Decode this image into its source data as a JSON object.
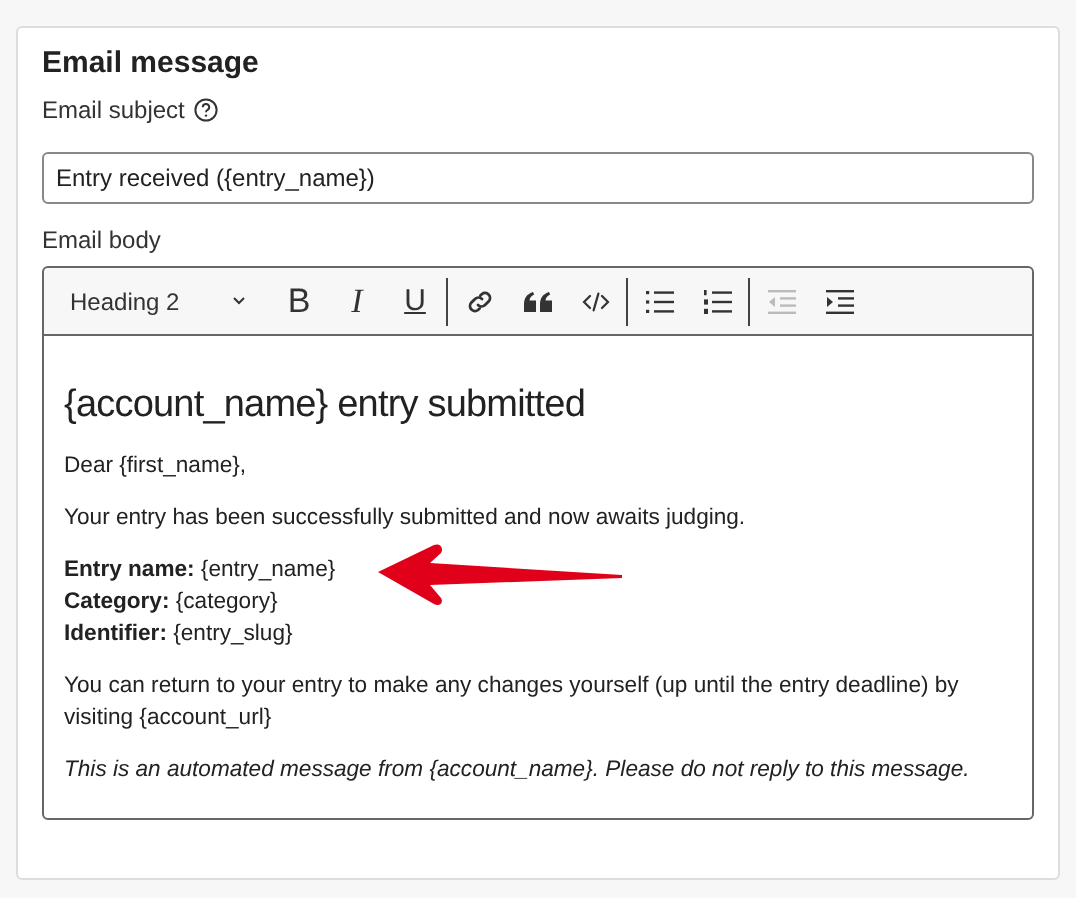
{
  "card": {
    "title": "Email message"
  },
  "subject": {
    "label": "Email subject",
    "value": "Entry received ({entry_name})"
  },
  "body": {
    "label": "Email body",
    "toolbar": {
      "block_style": "Heading 2",
      "groups": [
        [
          {
            "kind": "text",
            "label": "B",
            "disabled": false
          },
          {
            "kind": "text",
            "label": "I",
            "disabled": false
          },
          {
            "kind": "text",
            "label": "U",
            "disabled": false
          }
        ],
        [
          {
            "kind": "link",
            "disabled": false
          },
          {
            "kind": "quote",
            "disabled": false
          },
          {
            "kind": "code",
            "disabled": false
          }
        ],
        [
          {
            "kind": "bullets",
            "disabled": false
          },
          {
            "kind": "numbers",
            "disabled": false
          }
        ],
        [
          {
            "kind": "outdent",
            "disabled": true
          },
          {
            "kind": "indent",
            "disabled": false
          }
        ]
      ]
    },
    "content": [
      {
        "kind": "heading",
        "text": "{account_name} entry submitted"
      },
      {
        "kind": "paragraph",
        "text": "Dear {first_name},"
      },
      {
        "kind": "paragraph",
        "text": "Your entry has been successfully submitted and now awaits judging."
      },
      {
        "kind": "lines",
        "lines": [
          "**Entry name:** {entry_name}",
          "**Category:** {category}",
          "**Identifier:** {entry_slug}"
        ]
      },
      {
        "kind": "paragraph",
        "text": "You can return to your entry to make any changes yourself (up until the entry deadline) by visiting {account_url}"
      },
      {
        "kind": "note",
        "text": "This is an automated message from {account_name}. Please do not reply to this message."
      }
    ]
  }
}
